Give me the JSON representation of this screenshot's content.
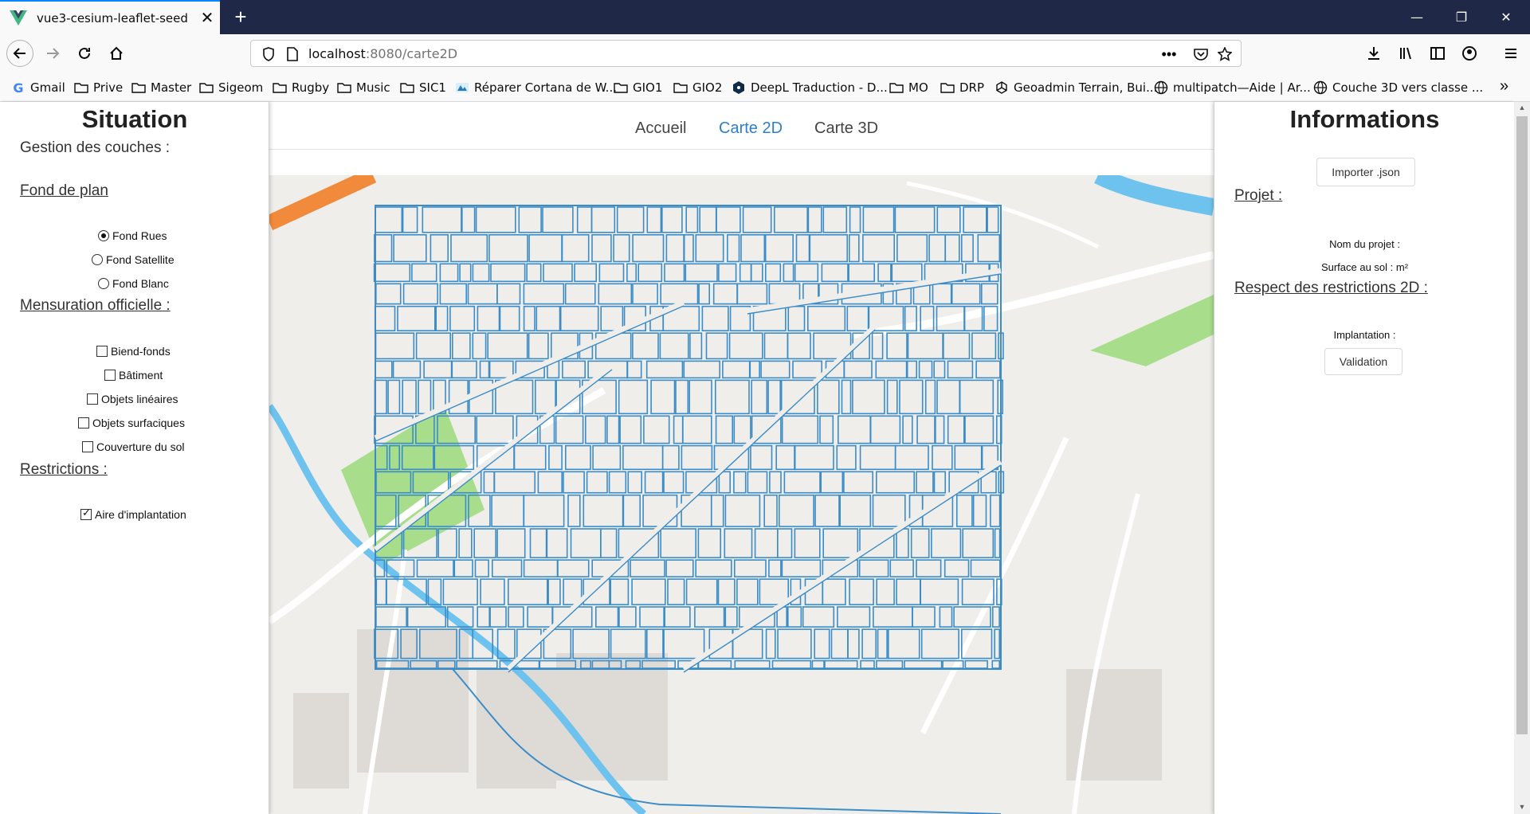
{
  "browser": {
    "tab_title": "vue3-cesium-leaflet-seed",
    "url_host": "localhost",
    "url_path": ":8080/carte2D",
    "bookmarks": [
      "Gmail",
      "Prive",
      "Master",
      "Sigeom",
      "Rugby",
      "Music",
      "SIC1",
      "Réparer Cortana de W...",
      "GIO1",
      "GIO2",
      "DeepL Traduction - D...",
      "MO",
      "DRP",
      "Geoadmin Terrain, Bui...",
      "multipatch—Aide | Ar...",
      "Couche 3D vers classe ..."
    ]
  },
  "nav": {
    "links": [
      "Accueil",
      "Carte 2D",
      "Carte 3D"
    ],
    "active": "Carte 2D"
  },
  "left": {
    "title": "Situation",
    "subtitle": "Gestion des couches :",
    "fond_title": "Fond de plan",
    "fond_options": [
      "Fond Rues",
      "Fond Satellite",
      "Fond Blanc"
    ],
    "fond_selected": "Fond Rues",
    "mo_title": "Mensuration officielle :",
    "mo_options": [
      "Biend-fonds",
      "Bâtiment",
      "Objets linéaires",
      "Objets surfaciques",
      "Couverture du sol"
    ],
    "restr_title": "Restrictions :",
    "restr_options": [
      "Aire d'implantation"
    ],
    "restr_checked": true
  },
  "right": {
    "title": "Informations",
    "import_button": "Importer .json",
    "projet_title": "Projet :",
    "nom_label": "Nom du projet :",
    "surface_label": "Surface au sol : m²",
    "restr_title": "Respect des restrictions 2D :",
    "implantation_label": "Implantation :",
    "validation_button": "Validation"
  },
  "colors": {
    "accent": "#2d7fcb",
    "parcel_stroke": "#3b8cc7",
    "river": "#6ec3ee",
    "park": "#a8dd8c",
    "road_major": "#f28a3c"
  }
}
